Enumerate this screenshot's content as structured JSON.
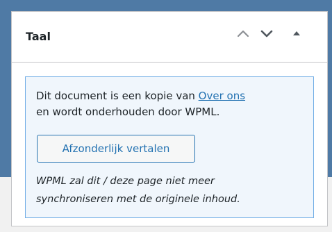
{
  "panel": {
    "title": "Taal",
    "icons": {
      "move_up": "chevron-up-icon",
      "move_down": "chevron-down-icon",
      "toggle": "caret-up-icon"
    }
  },
  "notice": {
    "text_before_link": "Dit document is een kopie van ",
    "link_text": "Over ons",
    "text_line2": "en wordt onderhouden door WPML.",
    "button_label": "Afzonderlijk vertalen",
    "italic_line1": "WPML zal dit / deze page niet meer",
    "italic_line2": "synchroniseren met de originele inhoud."
  },
  "colors": {
    "background_accent": "#4f7aa5",
    "link": "#2271b1",
    "notice_background": "#f0f6fc",
    "notice_border": "#72aee6"
  }
}
